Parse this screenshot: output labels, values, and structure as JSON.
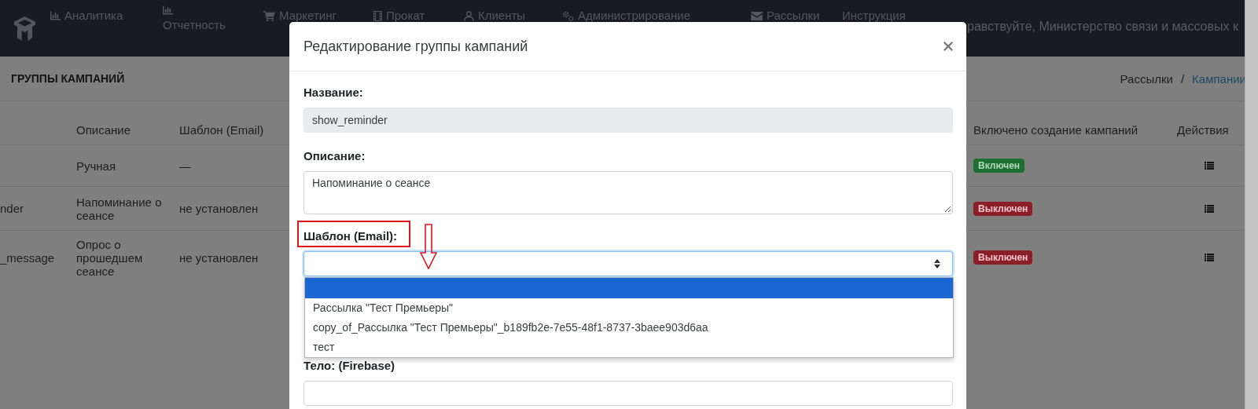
{
  "navbar": {
    "items": [
      {
        "label": "Аналитика",
        "kind": "chart"
      },
      {
        "label": "Отчетность",
        "kind": "chart"
      },
      {
        "label": "Маркетинг",
        "kind": "cart"
      },
      {
        "label": "Прокат",
        "kind": "film"
      },
      {
        "label": "Клиенты",
        "kind": "user"
      },
      {
        "label": "Администрирование",
        "kind": "gears"
      },
      {
        "label": "Рассылки",
        "kind": "mail"
      },
      {
        "label": "Инструкция"
      }
    ],
    "greeting": "равствуйте, Министерство связи и массовых к"
  },
  "page_header": {
    "title": "ГРУППЫ КАМПАНИЙ",
    "separator": "/",
    "breadcrumbs": [
      {
        "label": "Рассылки",
        "link": false
      },
      {
        "label": "Кампании",
        "link": true
      }
    ]
  },
  "table": {
    "columns": [
      "Описание",
      "Шаблон (Email)",
      "Включено создание кампаний",
      "Действия"
    ],
    "rows": [
      {
        "description": "Ручная",
        "template": "—",
        "enabled": true,
        "status": "Включен"
      },
      {
        "column_1": "nder",
        "description": "Напоминание о сеансе",
        "template": "не установлен",
        "enabled": false,
        "status": "Выключен"
      },
      {
        "column_1": "_message",
        "description": "Опрос о прошедшем сеансе",
        "template": "не установлен",
        "enabled": false,
        "status": "Выключен"
      }
    ]
  },
  "modal": {
    "title": "Редактирование группы кампаний",
    "fields": [
      {
        "kind": "input",
        "label": "Название:",
        "value": "show_reminder",
        "disabled": true,
        "focused": false
      },
      {
        "kind": "textarea",
        "label": "Описание:",
        "value": "Напоминание о сеансе",
        "disabled": false,
        "focused": false
      },
      {
        "kind": "select",
        "label": "Шаблон (Email):",
        "disabled": false,
        "focused": true,
        "annotated": true,
        "expanded": true,
        "options": [
          {
            "selected": true
          },
          {
            "label": "Рассылка \"Тест Премьеры\"",
            "selected": false
          },
          {
            "label": "copy_of_Рассылка \"Тест Премьеры\"_b189fb2e-7e55-48f1-8737-3baee903d6aa",
            "selected": false
          },
          {
            "label": "тест",
            "selected": false
          }
        ]
      },
      {
        "kind": "input",
        "label": "Тело: (Firebase)",
        "disabled": false,
        "focused": false
      }
    ]
  }
}
